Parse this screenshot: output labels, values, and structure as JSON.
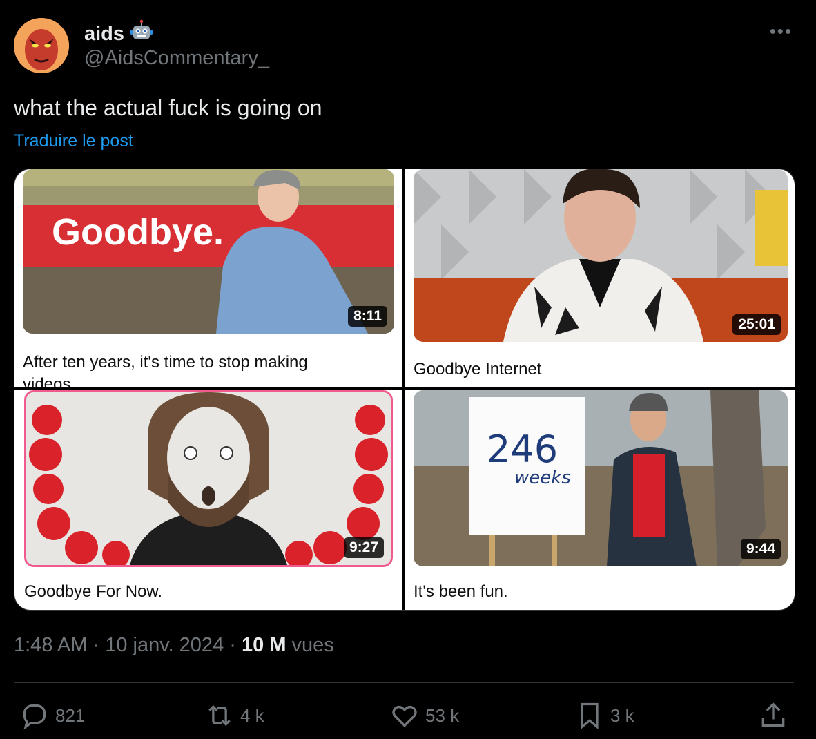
{
  "author": {
    "display_name": "aids",
    "handle": "@AidsCommentary_",
    "badge_icon": "robot-emoji"
  },
  "tweet": {
    "text": "what the actual fuck is going on",
    "translate_label": "Traduire le post"
  },
  "media": {
    "videos": [
      {
        "caption": "After ten years, it's time to stop making videos",
        "duration": "8:11",
        "thumb_text": "Goodbye."
      },
      {
        "caption": "Goodbye Internet",
        "duration": "25:01"
      },
      {
        "caption": "Goodbye For Now.",
        "duration": "9:27"
      },
      {
        "caption": "It's been fun.",
        "duration": "9:44",
        "thumb_text_1": "246",
        "thumb_text_2": "weeks"
      }
    ]
  },
  "meta": {
    "time": "1:48 AM",
    "date": "10 janv. 2024",
    "views_count": "10 M",
    "views_label": "vues"
  },
  "actions": {
    "replies": "821",
    "reposts": "4 k",
    "likes": "53 k",
    "bookmarks": "3 k"
  },
  "colors": {
    "background": "#000000",
    "accent": "#1d9bf0",
    "muted": "#71767b"
  }
}
